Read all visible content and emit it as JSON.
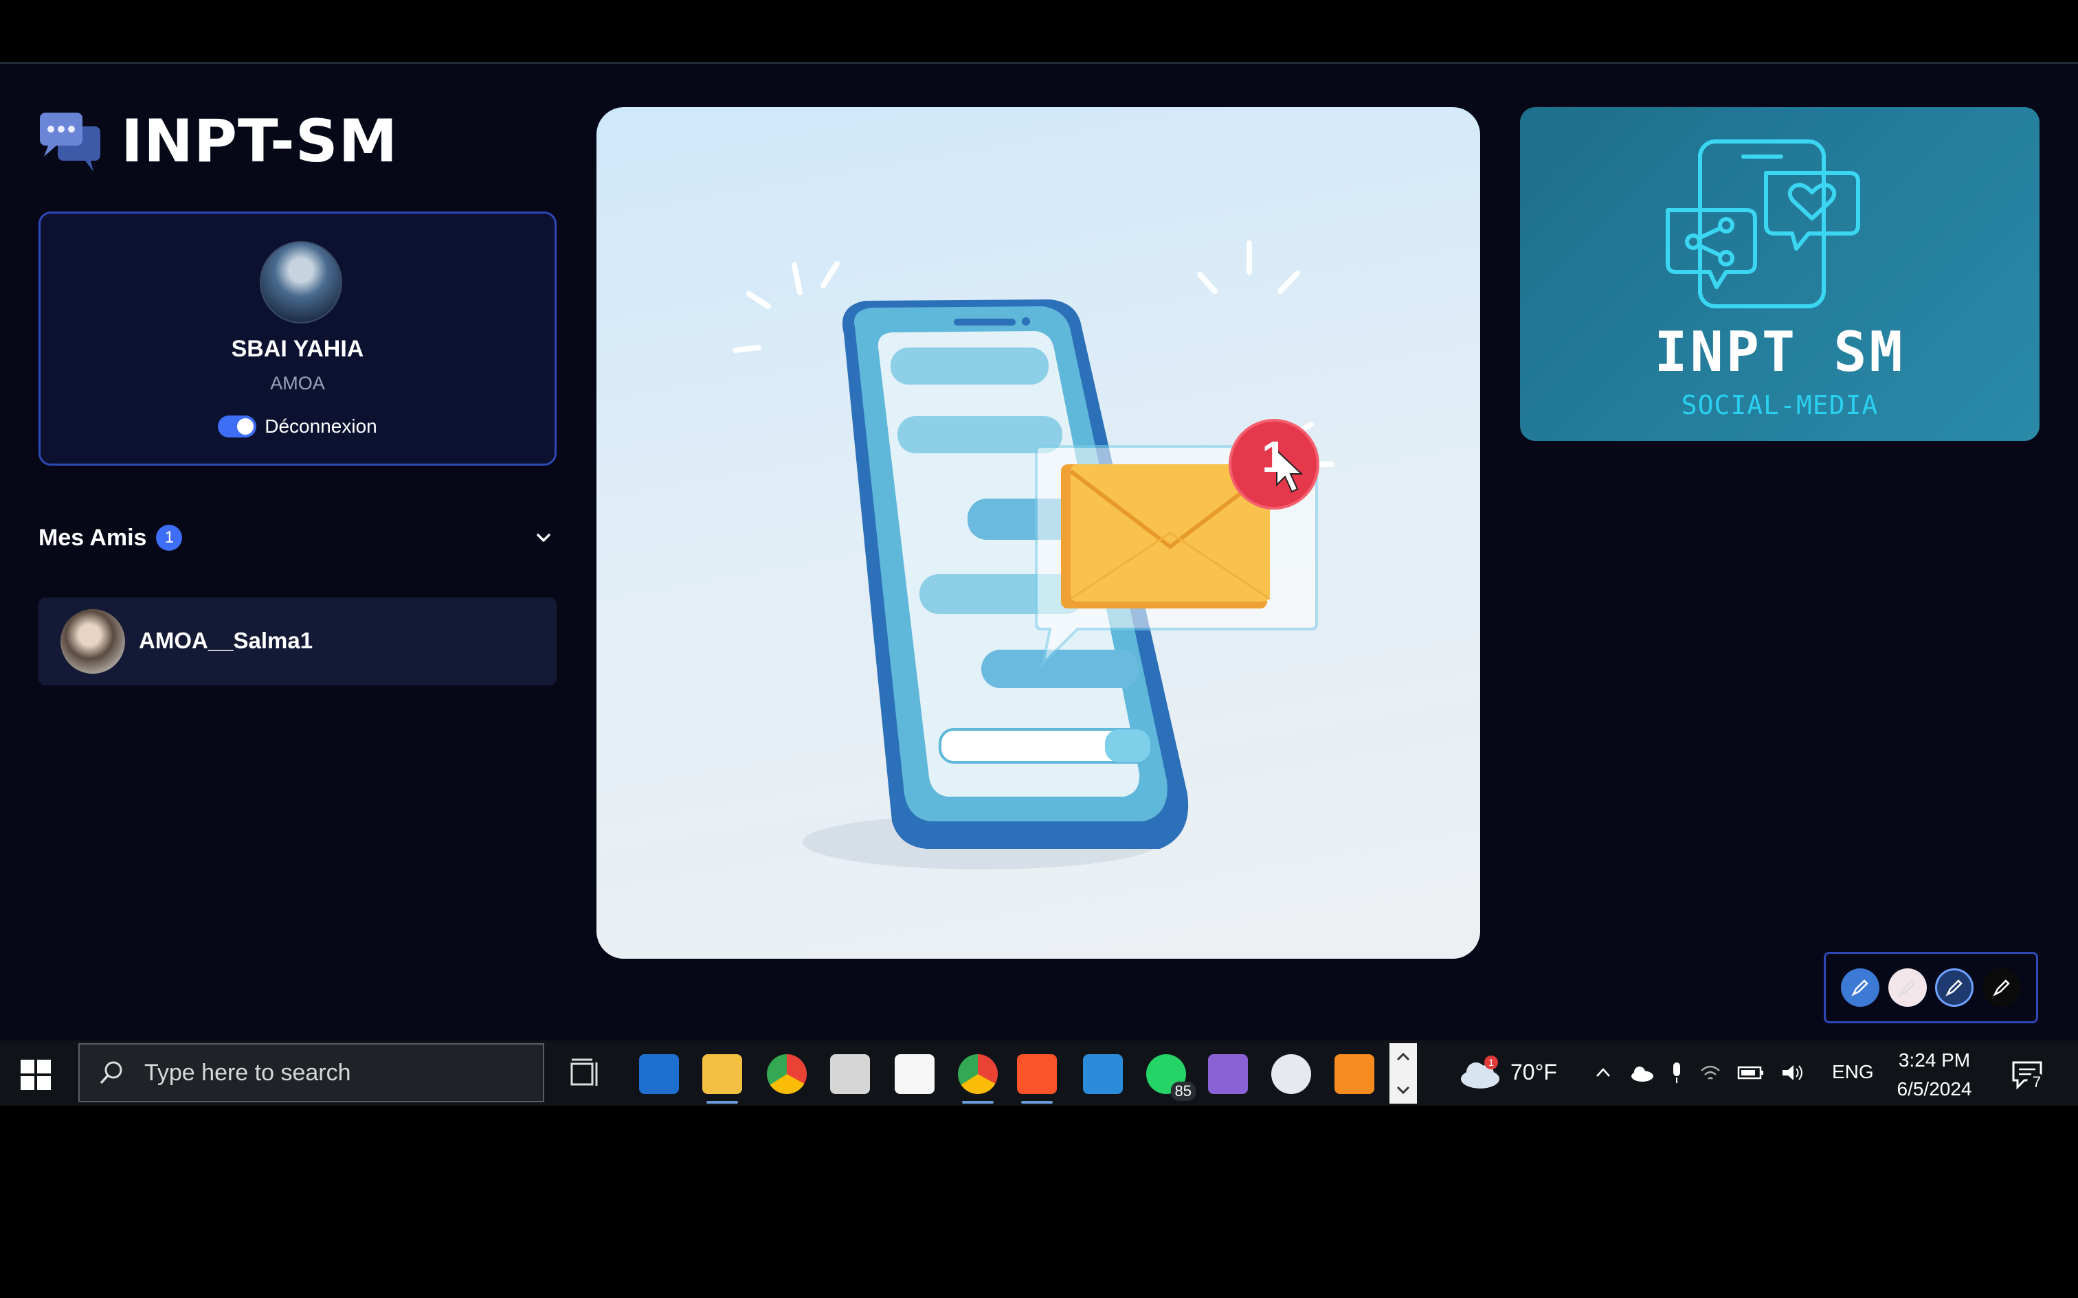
{
  "app": {
    "brand": "INPT-SM"
  },
  "profile": {
    "name": "SBAI YAHIA",
    "role": "AMOA",
    "logout_label": "Déconnexion",
    "logout_toggle_on": true
  },
  "friends": {
    "title": "Mes Amis",
    "count": "1",
    "items": [
      {
        "name": "AMOA__Salma1"
      }
    ]
  },
  "hero": {
    "notification_count": "1"
  },
  "brand_card": {
    "title": "INPT SM",
    "subtitle": "SOCIAL-MEDIA"
  },
  "pen_tools": [
    {
      "icon": "pen-icon",
      "color": "#3d7ad6"
    },
    {
      "icon": "pen-icon",
      "color": "#f3e6ea"
    },
    {
      "icon": "pen-icon",
      "color": "#1e3a6e"
    },
    {
      "icon": "pen-icon",
      "color": "#0b0b0b"
    }
  ],
  "taskbar": {
    "search_placeholder": "Type here to search",
    "whatsapp_badge": "85",
    "weather_badge": "1",
    "temperature": "70°F",
    "language": "ENG",
    "time": "3:24 PM",
    "date": "6/5/2024",
    "notification_count": "7"
  },
  "colors": {
    "accent": "#3d6ef5",
    "background": "#060818",
    "card": "#0d1130"
  }
}
